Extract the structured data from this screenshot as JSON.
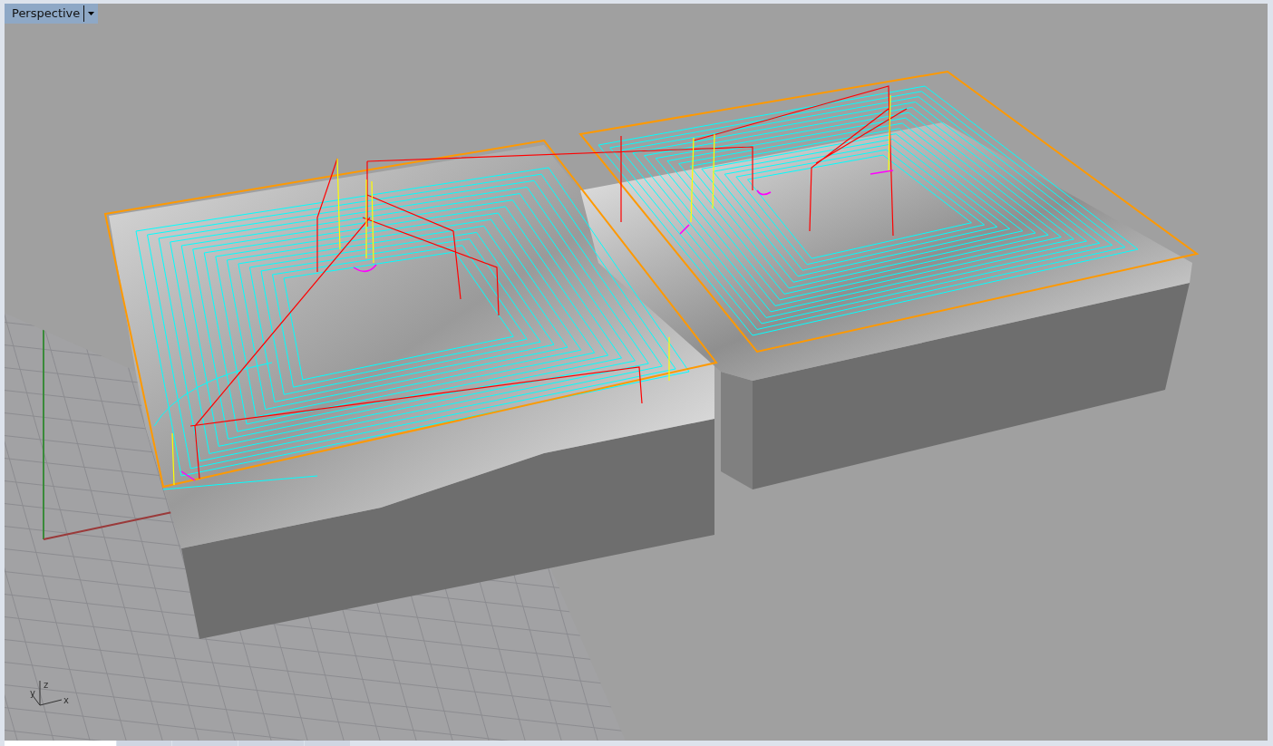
{
  "viewport": {
    "title": "Perspective",
    "axis_labels": [
      "z",
      "y",
      "x"
    ]
  },
  "bottom_tabs": [
    {
      "selected": true
    },
    {
      "selected": false
    },
    {
      "selected": false
    },
    {
      "selected": false
    },
    {
      "selected": false
    }
  ]
}
